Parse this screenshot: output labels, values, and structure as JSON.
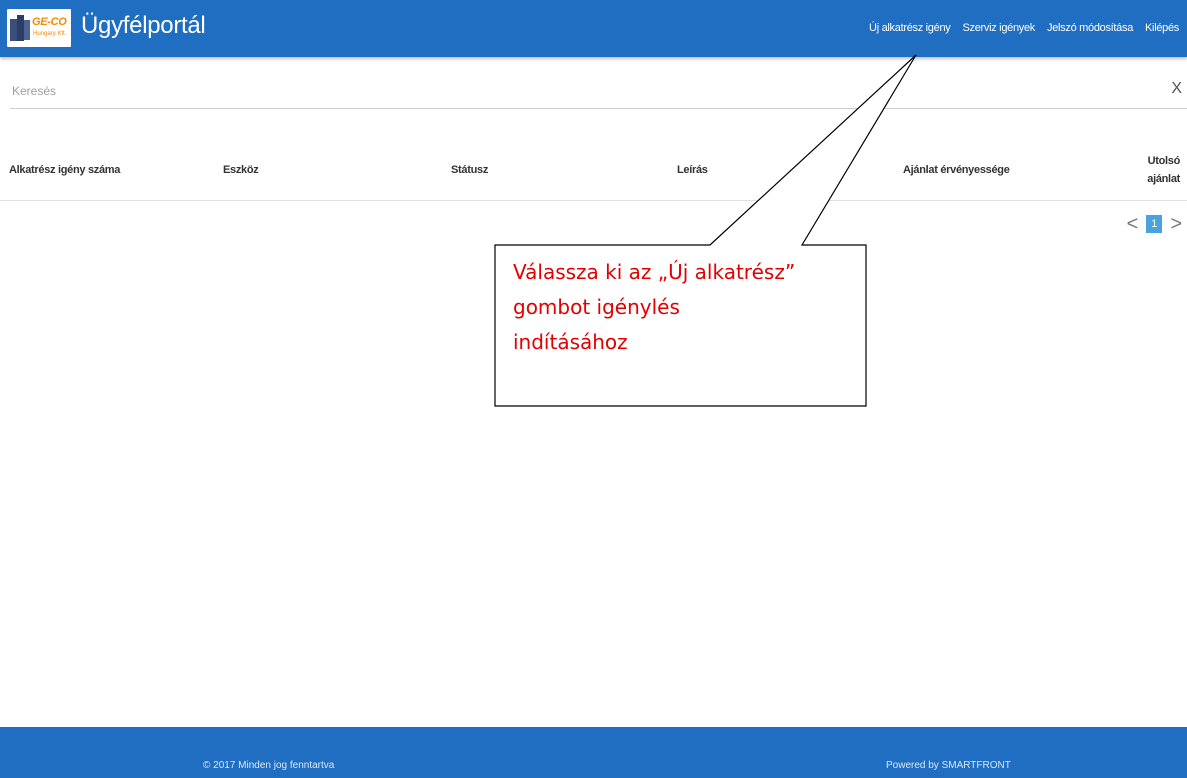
{
  "header": {
    "logo_brand": "GE-CO",
    "logo_sub": "Hungary Kft.",
    "title": "Ügyfélportál",
    "nav": [
      {
        "label": "Új alkatrész igény"
      },
      {
        "label": "Szerviz igények"
      },
      {
        "label": "Jelszó módosítása"
      },
      {
        "label": "Kilépés"
      }
    ]
  },
  "search": {
    "placeholder": "Keresés",
    "value": "",
    "clear_icon": "X"
  },
  "table": {
    "columns": [
      "Alkatrész igény száma",
      "Eszköz",
      "Státusz",
      "Leírás",
      "Ajánlat érvényessége",
      "Utolsó ajánlat"
    ],
    "rows": []
  },
  "pagination": {
    "prev": "<",
    "current": "1",
    "next": ">"
  },
  "callout": {
    "line1": "Válassza ki az „Új alkatrész”",
    "line2": "gombot igénylés",
    "line3": "indításához",
    "color": "#e30000"
  },
  "footer": {
    "copyright": "© 2017 Minden jog fenntartva",
    "powered": "Powered by SMARTFRONT"
  },
  "colors": {
    "primary": "#1f6ec1",
    "page_active": "#4aa3df",
    "logo_orange": "#f08c00"
  }
}
